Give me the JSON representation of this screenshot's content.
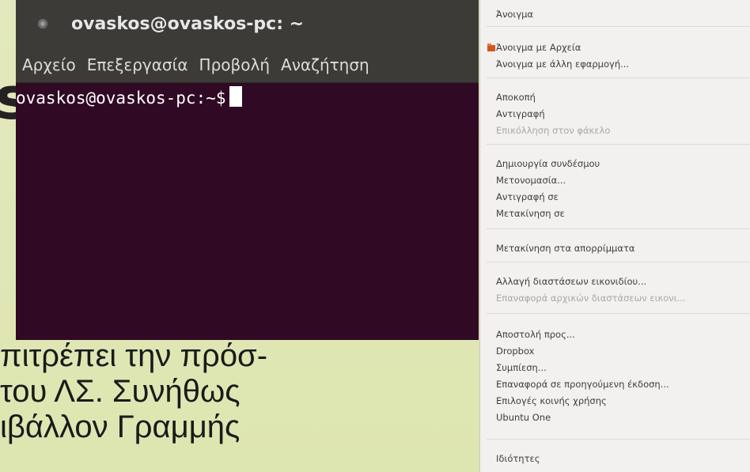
{
  "slide": {
    "title_fragment": "s",
    "body_lines": [
      "πιτρέπει την πρόσ-",
      "του ΛΣ. Συνήθως",
      "ιβάλλον Γραμμής"
    ]
  },
  "terminal": {
    "title": "ovaskos@ovaskos-pc: ~",
    "menu": [
      "Αρχείο",
      "Επεξεργασία",
      "Προβολή",
      "Αναζήτηση"
    ],
    "prompt": "ovaskos@ovaskos-pc:~$"
  },
  "context_menu": {
    "items": [
      {
        "label": "Άνοιγμα"
      },
      {
        "label": "Άνοιγμα με Αρχεία",
        "icon": "files-app-icon"
      },
      {
        "label": "Άνοιγμα με άλλη εφαρμογή..."
      },
      {
        "label": "Αποκοπή"
      },
      {
        "label": "Αντιγραφή"
      },
      {
        "label": "Επικόλληση στον φάκελο",
        "disabled": true
      },
      {
        "label": "Δημιουργία συνδέσμου"
      },
      {
        "label": "Μετονομασία..."
      },
      {
        "label": "Αντιγραφή σε"
      },
      {
        "label": "Μετακίνηση σε"
      },
      {
        "label": "Μετακίνηση στα απορρίμματα"
      },
      {
        "label": "Αλλαγή διαστάσεων εικονιδίου..."
      },
      {
        "label": "Επαναφορά αρχικών διαστάσεων εικονι...",
        "disabled": true
      },
      {
        "label": "Αποστολή προς..."
      },
      {
        "label": "Dropbox"
      },
      {
        "label": "Συμπίεση..."
      },
      {
        "label": "Επαναφορά σε προηγούμενη έκδοση..."
      },
      {
        "label": "Επιλογές κοινής χρήσης"
      },
      {
        "label": "Ubuntu One"
      },
      {
        "label": "Ιδιότητες"
      }
    ]
  },
  "colors": {
    "terminal_bg": "#300a24",
    "slide_bg": "#dfe6b6",
    "menu_bg": "#f2f1f0"
  }
}
